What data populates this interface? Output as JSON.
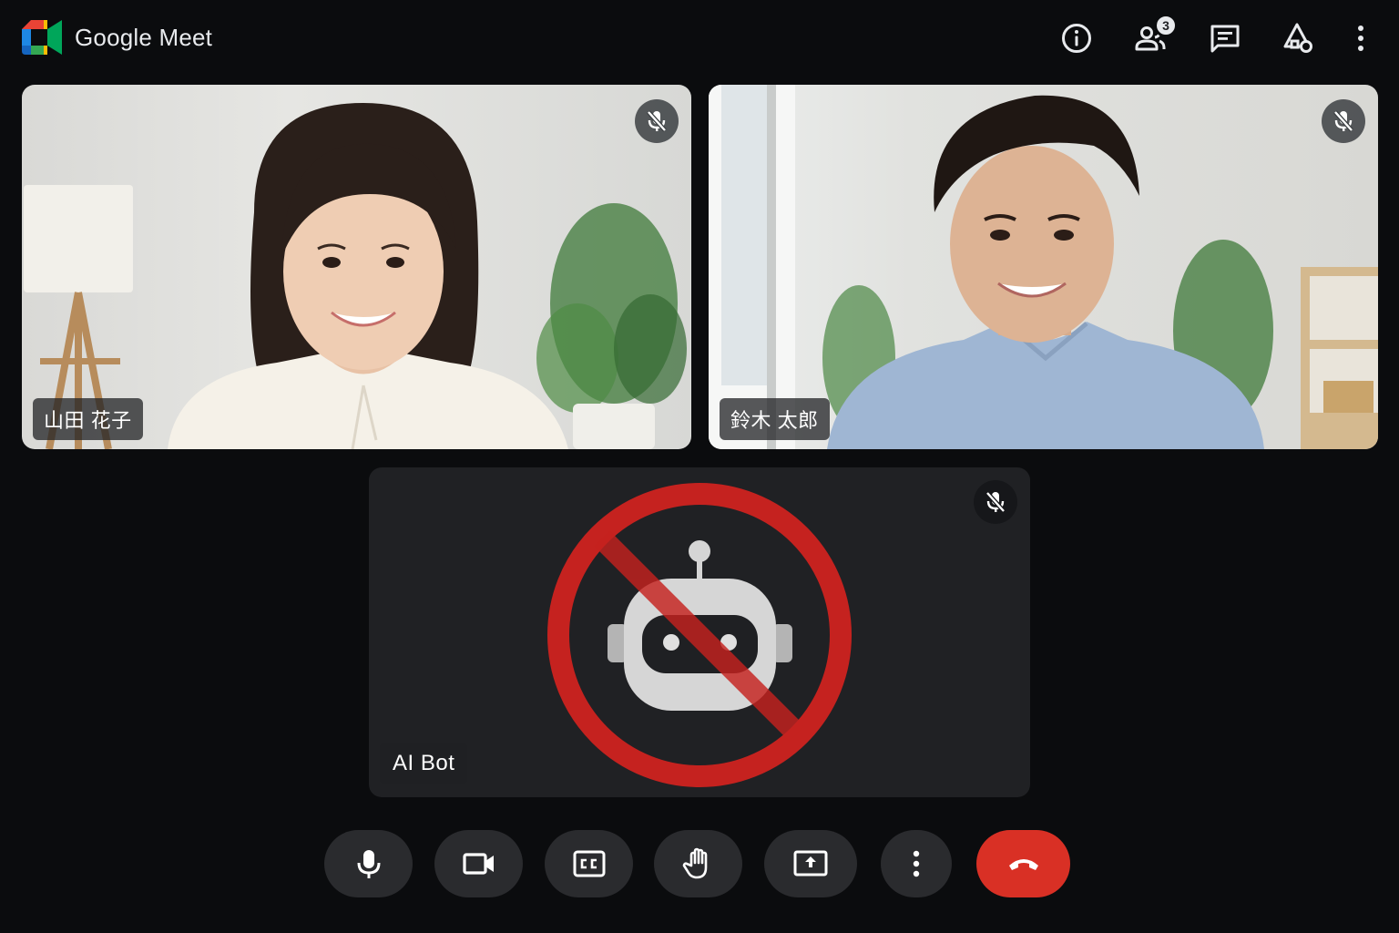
{
  "header": {
    "app_title": "Google Meet",
    "participants_count": "3",
    "icons": [
      "info-icon",
      "people-icon",
      "chat-icon",
      "activities-icon",
      "more-vert-icon"
    ]
  },
  "tiles": [
    {
      "name": "山田 花子",
      "muted": true
    },
    {
      "name": "鈴木 太郎",
      "muted": true
    },
    {
      "name": "AI Bot",
      "muted": true,
      "blocked": true
    }
  ],
  "controls": [
    "mic-icon",
    "camera-icon",
    "captions-icon",
    "raise-hand-icon",
    "present-icon",
    "more-vert-icon",
    "end-call-icon"
  ],
  "colors": {
    "background": "#0b0c0e",
    "control": "#2a2b2e",
    "end_call": "#d93025",
    "block_sign": "#c5221f",
    "bot_tile": "#202124"
  }
}
